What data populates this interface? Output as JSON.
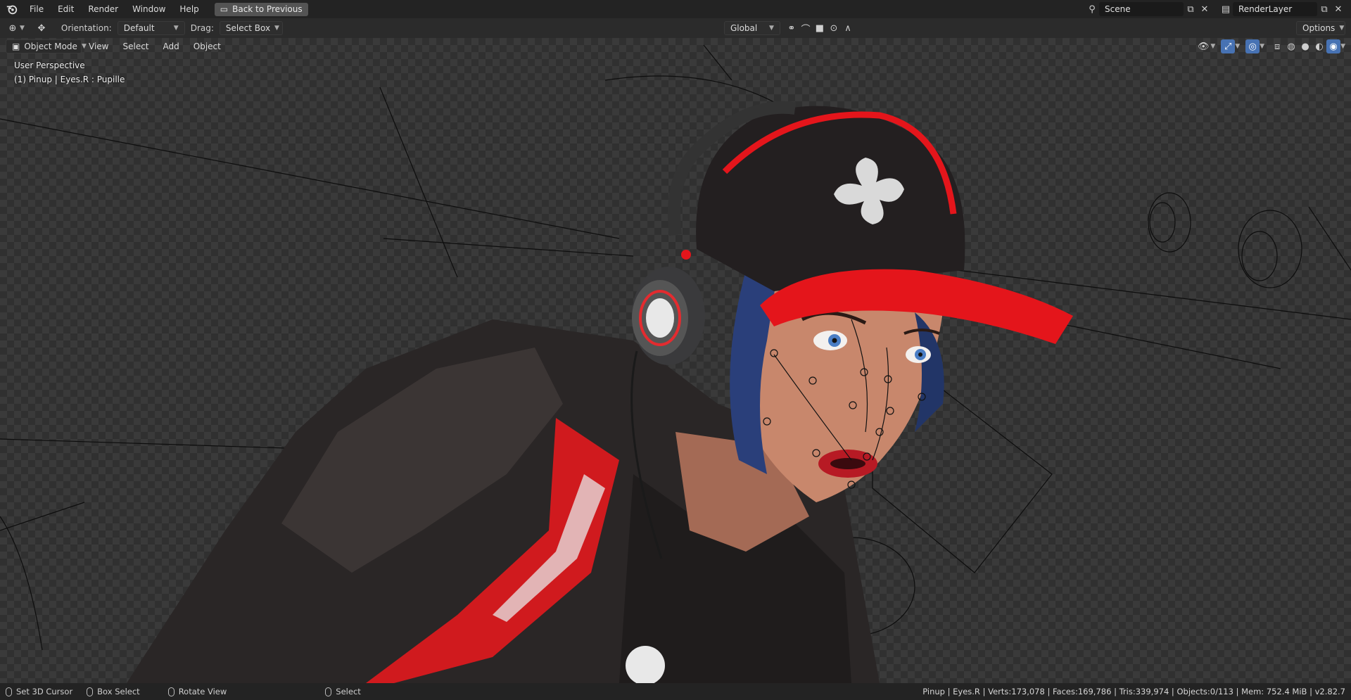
{
  "topbar": {
    "menus": [
      "File",
      "Edit",
      "Render",
      "Window",
      "Help"
    ],
    "back_button": "Back to Previous",
    "scene_name": "Scene",
    "render_layer": "RenderLayer"
  },
  "header": {
    "orientation_label": "Orientation:",
    "orientation_value": "Default",
    "drag_label": "Drag:",
    "drag_value": "Select Box",
    "transform_orientation": "Global",
    "options_label": "Options"
  },
  "viewport_header": {
    "mode": "Object Mode",
    "menus": [
      "View",
      "Select",
      "Add",
      "Object"
    ]
  },
  "viewport": {
    "perspective": "User Perspective",
    "selection": "(1) Pinup | Eyes.R : Pupille"
  },
  "statusbar": {
    "hint_cursor": "Set 3D Cursor",
    "hint_box": "Box Select",
    "hint_rotate": "Rotate View",
    "hint_select": "Select",
    "stats": "Pinup | Eyes.R | Verts:173,078 | Faces:169,786 | Tris:339,974 | Objects:0/113 | Mem: 752.4 MiB | v2.82.7"
  },
  "colors": {
    "accent_blue": "#4772b3",
    "cap_red": "#e4151b",
    "jacket": "#2a2626",
    "skin": "#c8876c",
    "hair": "#2a3f7a"
  }
}
